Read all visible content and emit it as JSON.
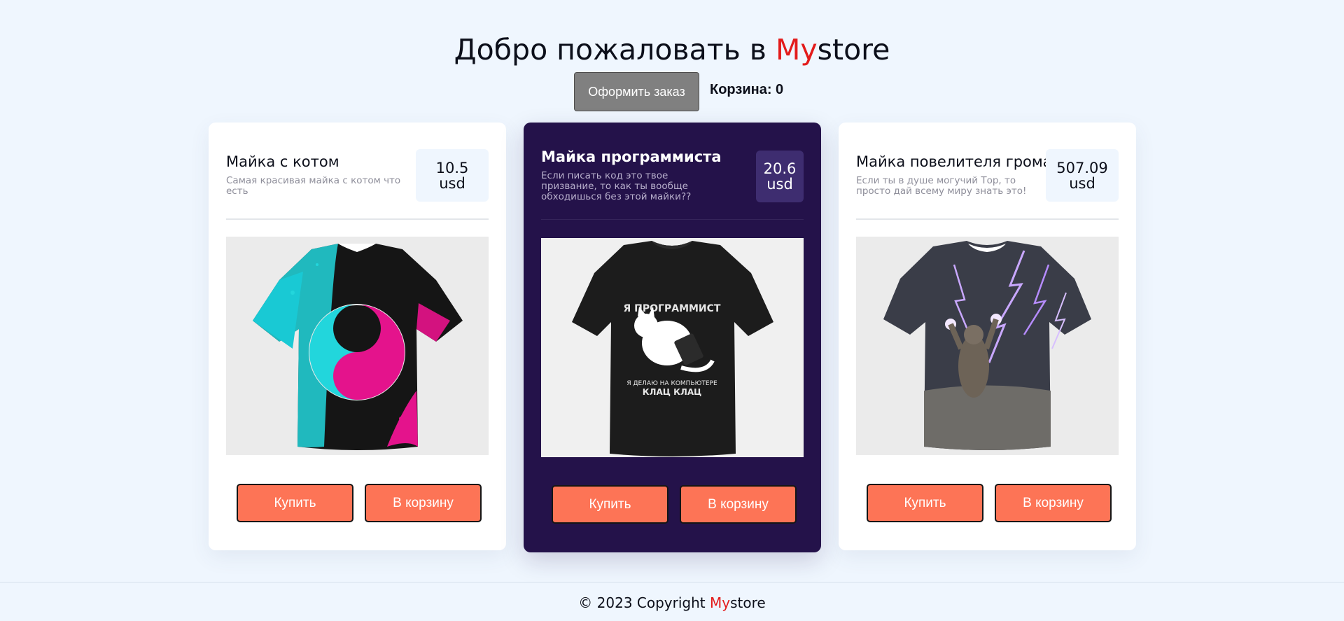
{
  "header": {
    "title_prefix": "Добро пожаловать в ",
    "brand_my": "My",
    "brand_store": "store",
    "order_button": "Оформить заказ",
    "cart_label": "Корзина: 0"
  },
  "products": [
    {
      "title": "Майка с котом",
      "description": "Самая красивая майка с котом что есть",
      "price": "10.5",
      "currency": "usd",
      "buy_label": "Купить",
      "cart_label": "В корзину",
      "image": "tshirt-yin-yang-cats"
    },
    {
      "title": "Майка программиста",
      "description": "Если писать код это твое призвание, то как ты вообще обходишься без этой майки??",
      "price": "20.6",
      "currency": "usd",
      "buy_label": "Купить",
      "cart_label": "В корзину",
      "image": "tshirt-programmer-cat",
      "print_line1": "Я ПРОГРАММИСТ",
      "print_line2": "Я ДЕЛАЮ НА КОМПЬЮТЕРЕ",
      "print_line3": "КЛАЦ КЛАЦ"
    },
    {
      "title": "Майка повелителя грома",
      "description": "Если ты в душе могучий Тор, то просто дай всему миру знать это!",
      "price": "507.09",
      "currency": "usd",
      "buy_label": "Купить",
      "cart_label": "В корзину",
      "image": "tshirt-lightning-cat"
    }
  ],
  "footer": {
    "prefix": "© 2023 Copyright ",
    "brand_my": "My",
    "brand_store": "store"
  },
  "colors": {
    "background": "#eff6fe",
    "accent_red": "#e31b1b",
    "button_orange": "#fd7456",
    "featured_card": "#24124a"
  }
}
